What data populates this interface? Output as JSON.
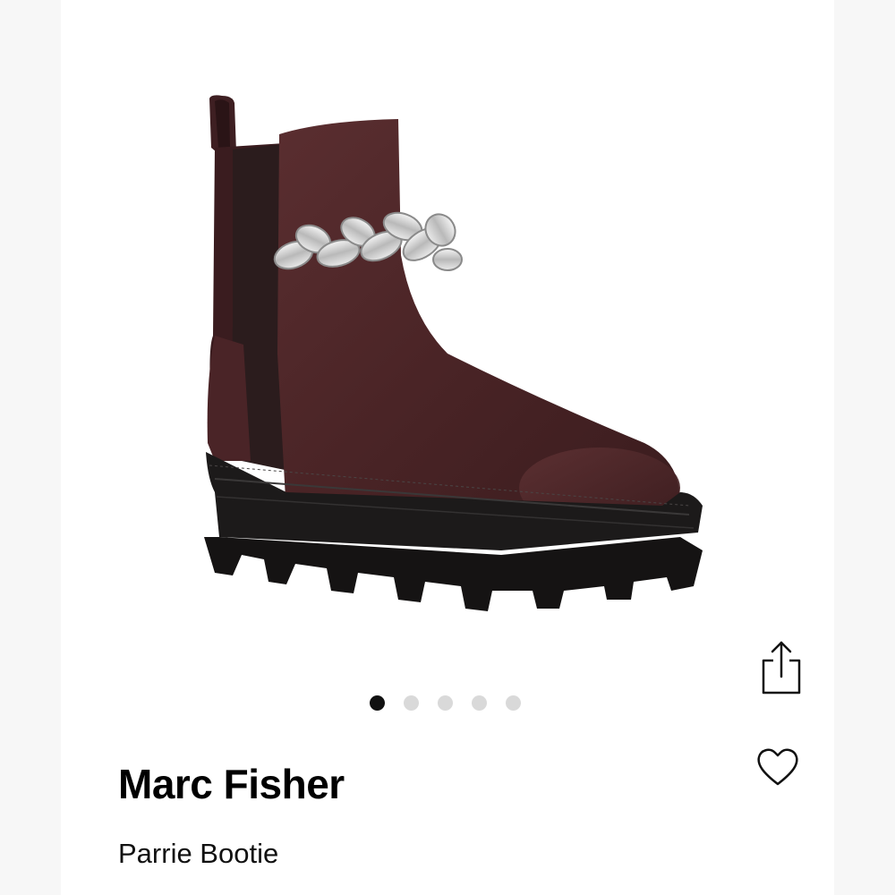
{
  "product": {
    "brand": "Marc Fisher",
    "name": "Parrie Bootie",
    "image_description_icon": "chelsea-boot-image",
    "colors": {
      "leather": "#4a2526",
      "sole": "#1c1a1a",
      "chain": "#d8d8d8"
    }
  },
  "carousel": {
    "total_images": 5,
    "active_index": 0
  },
  "actions": {
    "share_icon": "share-icon",
    "favorite_icon": "heart-icon"
  }
}
